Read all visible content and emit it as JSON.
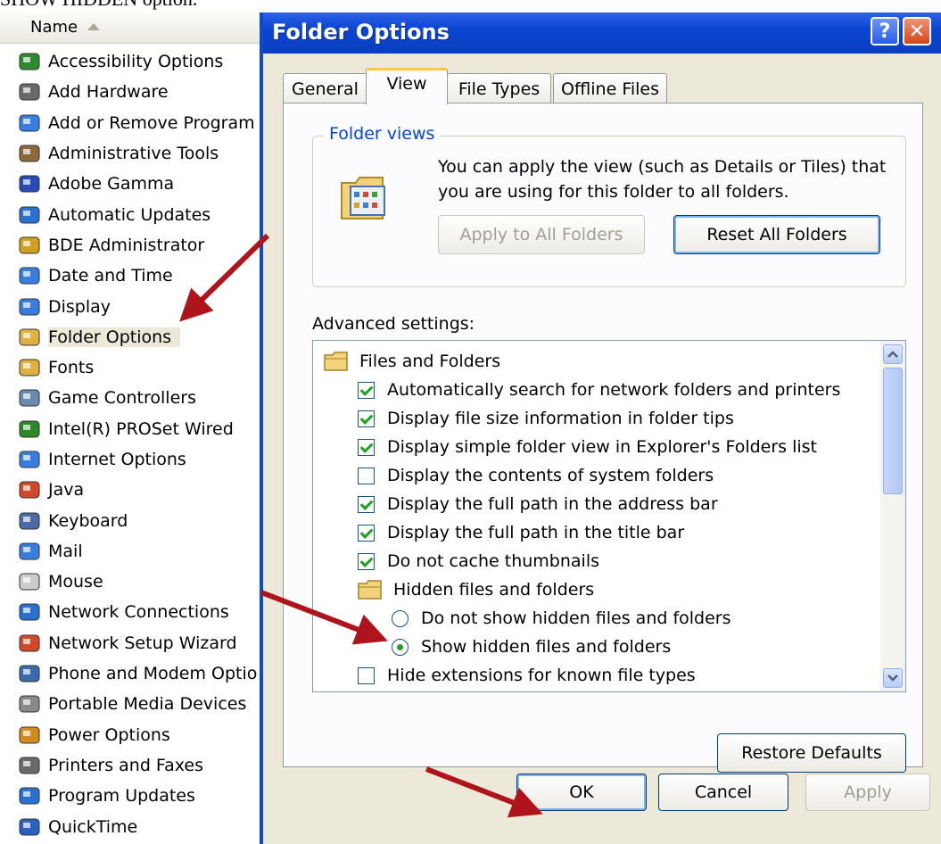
{
  "caption": "SHOW HIDDEN option.",
  "control_panel": {
    "column_header": "Name",
    "items": [
      {
        "label": "Accessibility Options",
        "icon": "accessibility-icon"
      },
      {
        "label": "Add Hardware",
        "icon": "hardware-icon"
      },
      {
        "label": "Add or Remove Program",
        "icon": "programs-icon"
      },
      {
        "label": "Administrative Tools",
        "icon": "admin-tools-icon"
      },
      {
        "label": "Adobe Gamma",
        "icon": "monitor-icon"
      },
      {
        "label": "Automatic Updates",
        "icon": "globe-icon"
      },
      {
        "label": "BDE Administrator",
        "icon": "bde-icon"
      },
      {
        "label": "Date and Time",
        "icon": "clock-icon"
      },
      {
        "label": "Display",
        "icon": "display-icon"
      },
      {
        "label": "Folder Options",
        "icon": "folder-options-icon"
      },
      {
        "label": "Fonts",
        "icon": "fonts-folder-icon"
      },
      {
        "label": "Game Controllers",
        "icon": "gamepad-icon"
      },
      {
        "label": "Intel(R) PROSet Wired",
        "icon": "network-card-icon"
      },
      {
        "label": "Internet Options",
        "icon": "internet-icon"
      },
      {
        "label": "Java",
        "icon": "java-icon"
      },
      {
        "label": "Keyboard",
        "icon": "keyboard-icon"
      },
      {
        "label": "Mail",
        "icon": "mail-icon"
      },
      {
        "label": "Mouse",
        "icon": "mouse-icon"
      },
      {
        "label": "Network Connections",
        "icon": "network-icon"
      },
      {
        "label": "Network Setup Wizard",
        "icon": "wizard-icon"
      },
      {
        "label": "Phone and Modem Optio",
        "icon": "phone-icon"
      },
      {
        "label": "Portable Media Devices",
        "icon": "media-device-icon"
      },
      {
        "label": "Power Options",
        "icon": "power-icon"
      },
      {
        "label": "Printers and Faxes",
        "icon": "printer-icon"
      },
      {
        "label": "Program Updates",
        "icon": "updates-icon"
      },
      {
        "label": "QuickTime",
        "icon": "quicktime-icon"
      }
    ]
  },
  "dialog": {
    "title": "Folder Options",
    "help_glyph": "?",
    "close_glyph": "✕",
    "tabs": [
      "General",
      "View",
      "File Types",
      "Offline Files"
    ],
    "active_tab": "View",
    "folder_views": {
      "title": "Folder views",
      "description": "You can apply the view (such as Details or Tiles) that you are using for this folder to all folders.",
      "apply_button": "Apply to All Folders",
      "reset_button": "Reset All Folders"
    },
    "advanced_label": "Advanced settings:",
    "advanced_items": [
      {
        "type": "folder",
        "label": "Files and Folders",
        "level": 0
      },
      {
        "type": "checkbox",
        "label": "Automatically search for network folders and printers",
        "checked": true,
        "level": 1
      },
      {
        "type": "checkbox",
        "label": "Display file size information in folder tips",
        "checked": true,
        "level": 1
      },
      {
        "type": "checkbox",
        "label": "Display simple folder view in Explorer's Folders list",
        "checked": true,
        "level": 1
      },
      {
        "type": "checkbox",
        "label": "Display the contents of system folders",
        "checked": false,
        "level": 1
      },
      {
        "type": "checkbox",
        "label": "Display the full path in the address bar",
        "checked": true,
        "level": 1
      },
      {
        "type": "checkbox",
        "label": "Display the full path in the title bar",
        "checked": true,
        "level": 1
      },
      {
        "type": "checkbox",
        "label": "Do not cache thumbnails",
        "checked": true,
        "level": 1
      },
      {
        "type": "folder",
        "label": "Hidden files and folders",
        "level": 1
      },
      {
        "type": "radio",
        "label": "Do not show hidden files and folders",
        "checked": false,
        "level": 2
      },
      {
        "type": "radio",
        "label": "Show hidden files and folders",
        "checked": true,
        "level": 2
      },
      {
        "type": "checkbox",
        "label": "Hide extensions for known file types",
        "checked": false,
        "level": 1
      }
    ],
    "restore_button": "Restore Defaults",
    "ok_button": "OK",
    "cancel_button": "Cancel",
    "apply_button": "Apply"
  },
  "colors": {
    "titlebar": "#0a46d0",
    "dialog_bg": "#ece9d8",
    "annotation_arrow": "#b0141b",
    "check_green": "#21a121"
  }
}
